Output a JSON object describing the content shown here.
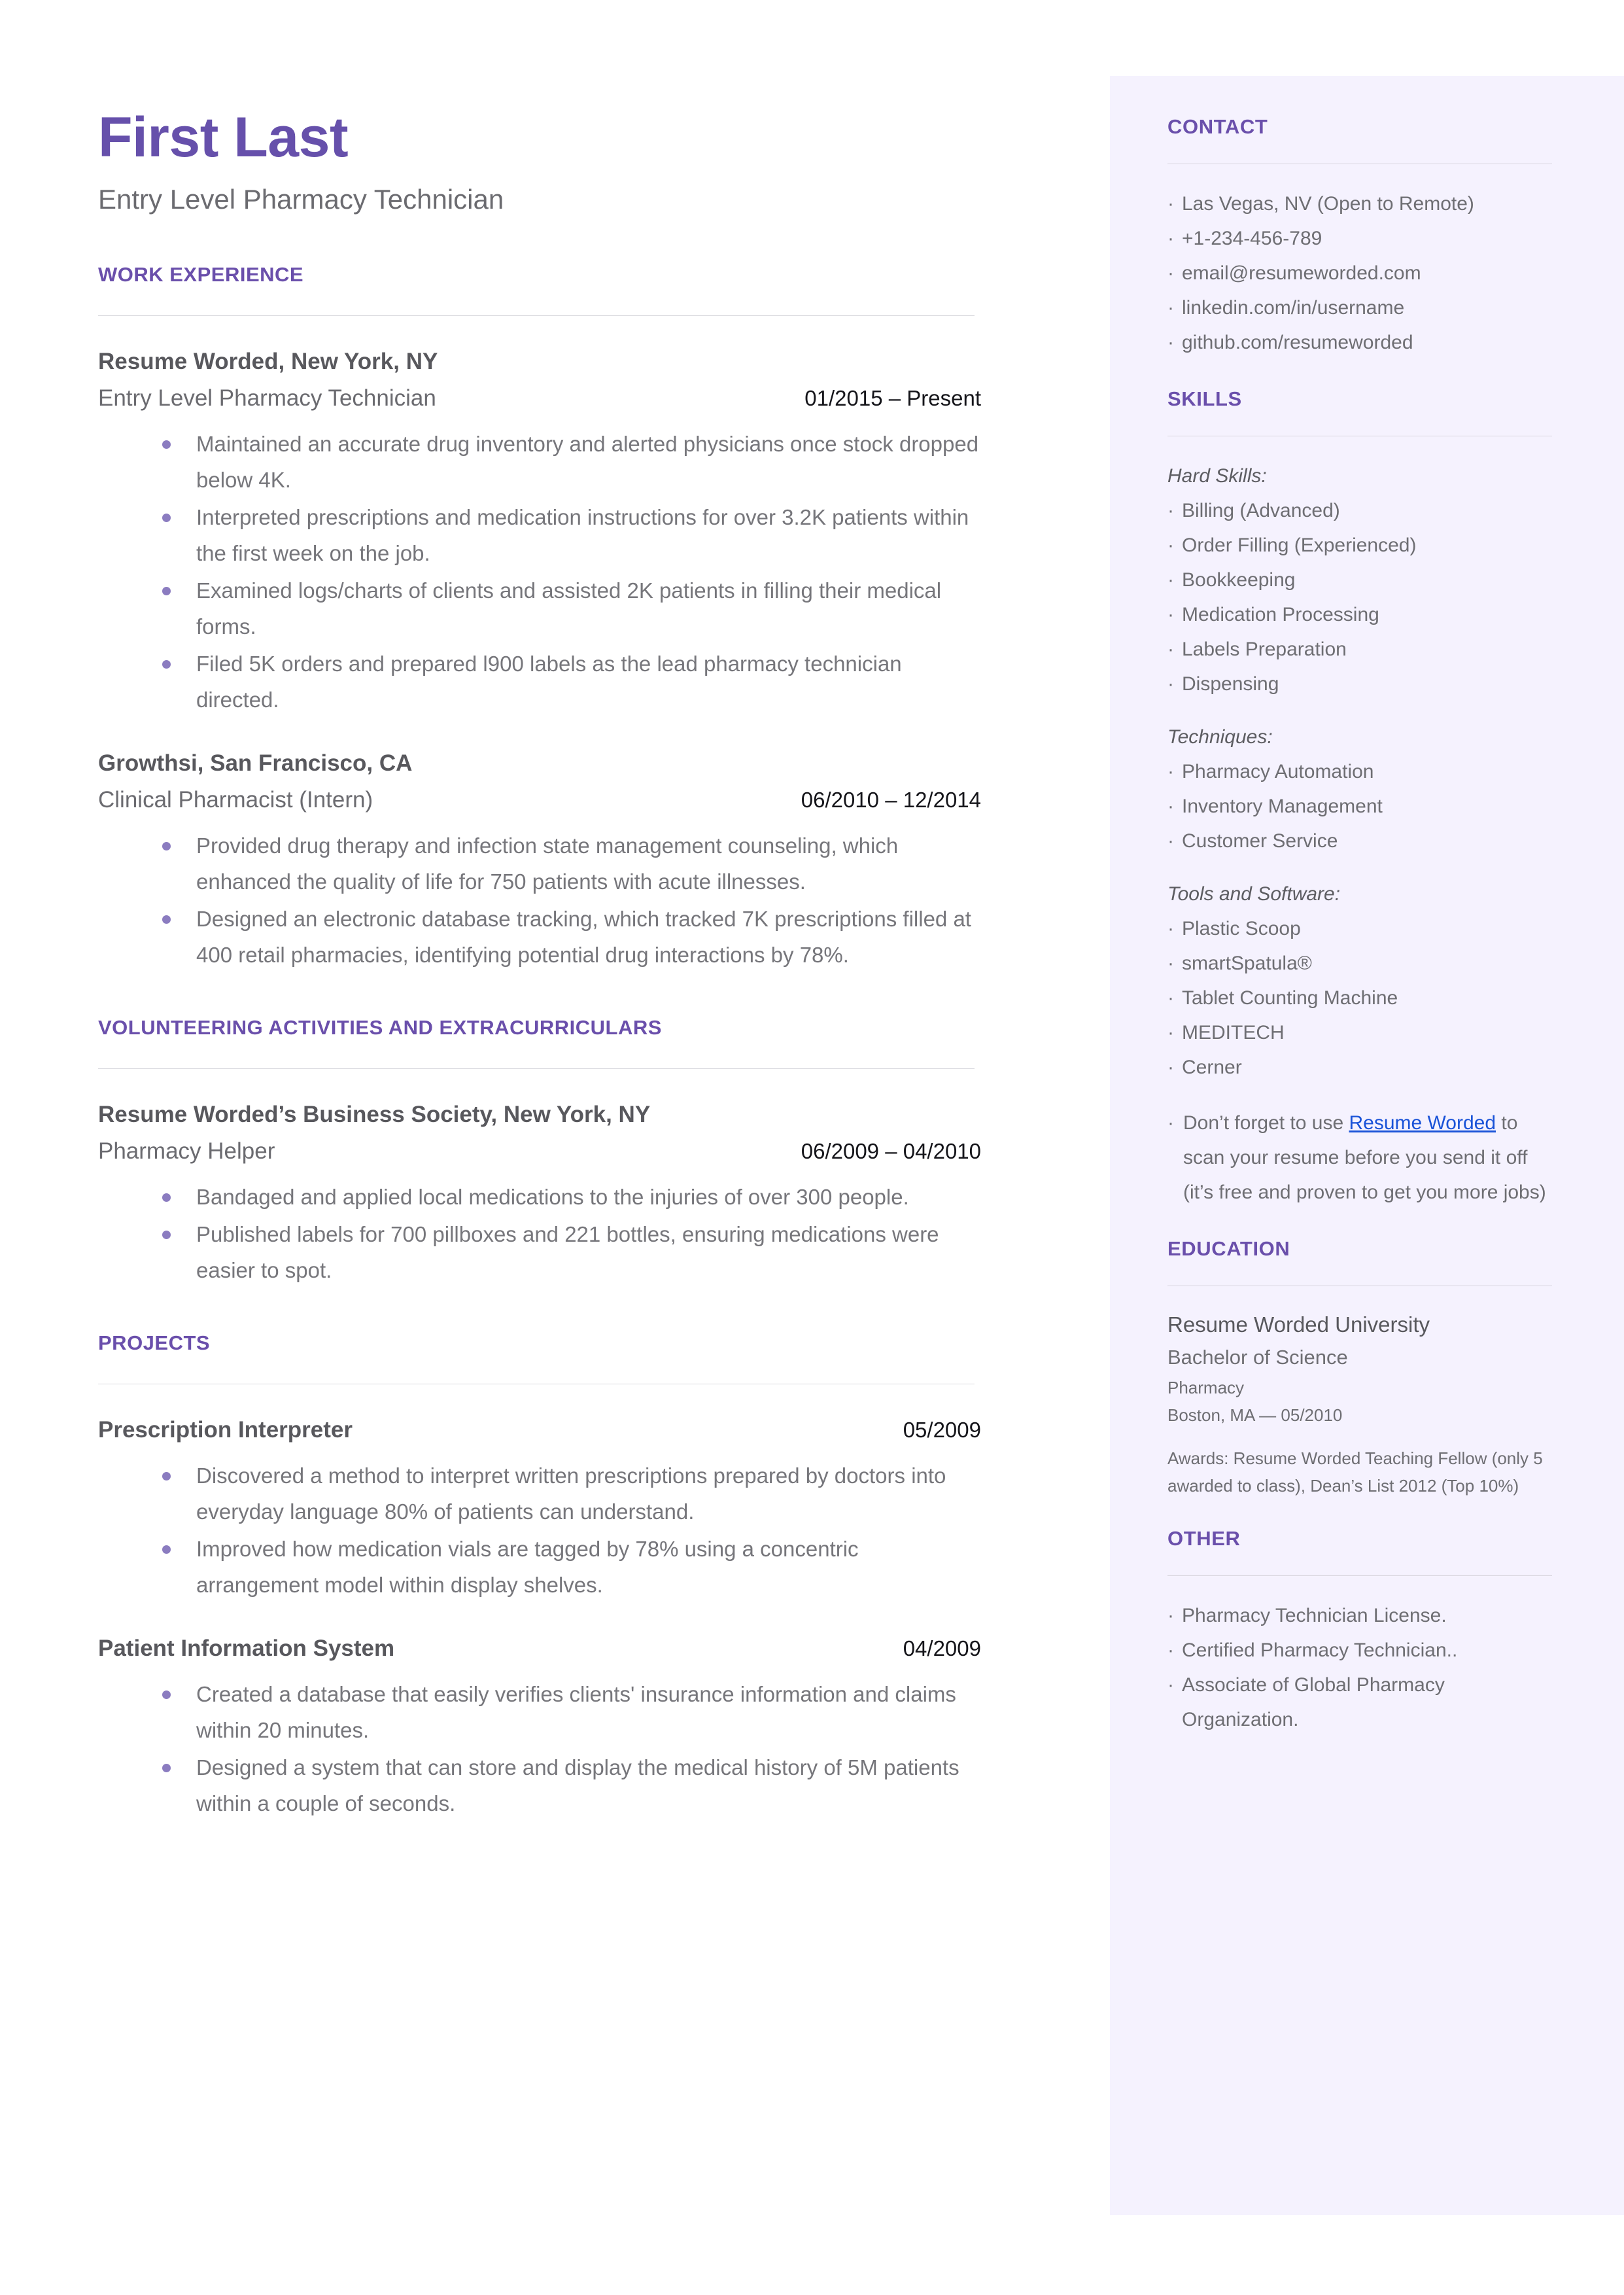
{
  "colors": {
    "accent": "#6a4fab",
    "name": "#6650ab",
    "sidebar_bg": "#f5f2fe",
    "bullet": "#8b7cc0",
    "link": "#1a53d8",
    "body_text": "#76767b",
    "rule": "#d9d9de"
  },
  "header": {
    "name": "First Last",
    "subtitle": "Entry Level Pharmacy Technician"
  },
  "sections": {
    "work_experience": {
      "heading": "WORK EXPERIENCE",
      "entries": [
        {
          "org": "Resume Worded, New York, NY",
          "role": "Entry Level Pharmacy Technician",
          "date": "01/2015 – Present",
          "bullets": [
            "Maintained an accurate drug inventory and alerted physicians once stock dropped below 4K.",
            "Interpreted prescriptions and medication instructions for over 3.2K patients within the first week on the job.",
            "Examined logs/charts of clients and assisted 2K patients in filling their medical forms.",
            "Filed 5K orders and prepared l900 labels as the lead pharmacy technician directed."
          ]
        },
        {
          "org": "Growthsi, San Francisco, CA",
          "role": "Clinical Pharmacist (Intern)",
          "date": "06/2010 – 12/2014",
          "bullets": [
            "Provided drug therapy and infection state management counseling, which enhanced the quality of life for 750 patients with acute illnesses.",
            "Designed an electronic database tracking, which tracked 7K prescriptions filled at 400 retail pharmacies, identifying potential drug interactions by 78%."
          ]
        }
      ]
    },
    "volunteering": {
      "heading": "VOLUNTEERING ACTIVITIES AND EXTRACURRICULARS",
      "entries": [
        {
          "org": "Resume Worded’s Business Society, New York, NY",
          "role": "Pharmacy Helper",
          "date": "06/2009 – 04/2010",
          "bullets": [
            "Bandaged and applied local medications to the injuries of over 300 people.",
            "Published labels for 700 pillboxes and 221 bottles, ensuring medications were easier to spot."
          ]
        }
      ]
    },
    "projects": {
      "heading": "PROJECTS",
      "entries": [
        {
          "title": "Prescription Interpreter",
          "date": "05/2009",
          "bullets": [
            "Discovered a method to interpret written prescriptions prepared by doctors into everyday language 80% of patients can understand.",
            "Improved how medication vials are tagged by 78% using a concentric arrangement model within display shelves."
          ]
        },
        {
          "title": "Patient Information System",
          "date": "04/2009",
          "bullets": [
            "Created a database that easily verifies clients' insurance information and claims within 20 minutes.",
            "Designed a system that can store and display the medical history of 5M patients within a couple of seconds."
          ]
        }
      ]
    }
  },
  "sidebar": {
    "contact": {
      "heading": "CONTACT",
      "items": [
        "Las Vegas, NV (Open to Remote)",
        "+1-234-456-789",
        "email@resumeworded.com",
        "linkedin.com/in/username",
        "github.com/resumeworded"
      ]
    },
    "skills": {
      "heading": "SKILLS",
      "groups": [
        {
          "label": "Hard Skills:",
          "items": [
            "Billing (Advanced)",
            "Order Filling (Experienced)",
            "Bookkeeping",
            "Medication Processing",
            "Labels Preparation",
            "Dispensing"
          ]
        },
        {
          "label": "Techniques:",
          "items": [
            "Pharmacy Automation",
            "Inventory Management",
            "Customer Service"
          ]
        },
        {
          "label": "Tools and Software:",
          "items": [
            "Plastic Scoop",
            "smartSpatula®",
            "Tablet Counting Machine",
            "MEDITECH",
            "Cerner"
          ]
        }
      ],
      "promo": {
        "prefix": "Don’t forget to use ",
        "link_text": "Resume Worded",
        "suffix": " to scan your resume before you send it off (it’s free and proven to get you more jobs)"
      }
    },
    "education": {
      "heading": "EDUCATION",
      "school": "Resume Worded University",
      "degree": "Bachelor of Science",
      "minor": "Pharmacy",
      "location": "Boston, MA — 05/2010",
      "awards": "Awards: Resume Worded Teaching Fellow (only 5 awarded to class), Dean’s List 2012 (Top 10%)"
    },
    "other": {
      "heading": "OTHER",
      "items": [
        "Pharmacy Technician License.",
        "Certified Pharmacy Technician..",
        "Associate of Global Pharmacy Organization."
      ]
    }
  }
}
